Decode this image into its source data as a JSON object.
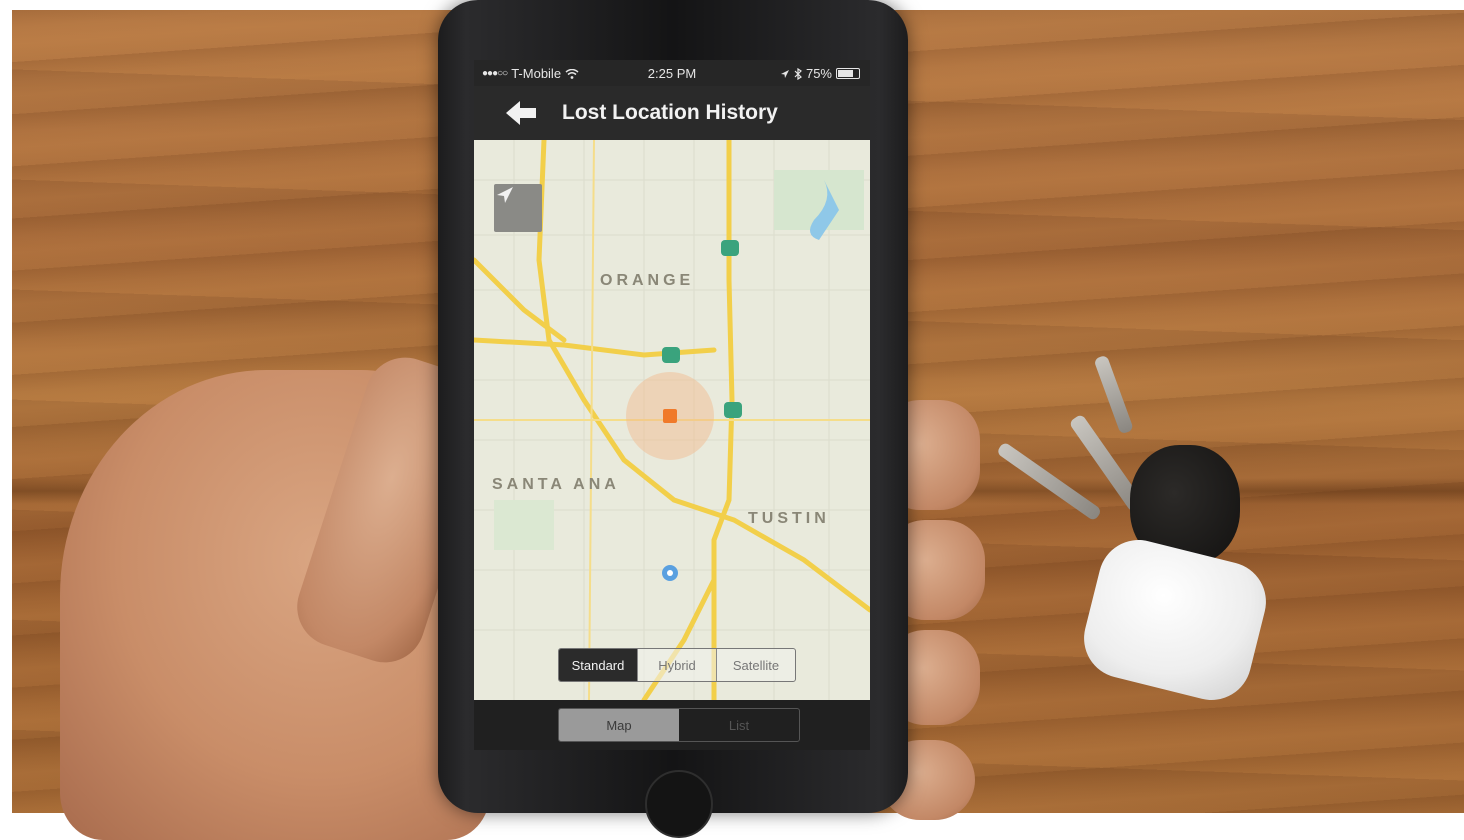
{
  "status_bar": {
    "signal": "●●●○○",
    "carrier": "T-Mobile",
    "time": "2:25 PM",
    "battery_percent": "75%",
    "battery_level": 0.75
  },
  "nav": {
    "title": "Lost Location History"
  },
  "map": {
    "labels": {
      "orange": "ORANGE",
      "santa_ana": "SANTA ANA",
      "tustin": "TUSTIN"
    },
    "map_type_tabs": [
      "Standard",
      "Hybrid",
      "Satellite"
    ],
    "map_type_selected": "Standard"
  },
  "view_tabs": {
    "items": [
      "Map",
      "List"
    ],
    "selected": "Map"
  },
  "colors": {
    "highway": "#f2cf4a",
    "marker": "#f07a2a",
    "marker_halo": "#f2b98a",
    "freeway_badge": "#3aa37d",
    "water": "#8fc8e8"
  }
}
